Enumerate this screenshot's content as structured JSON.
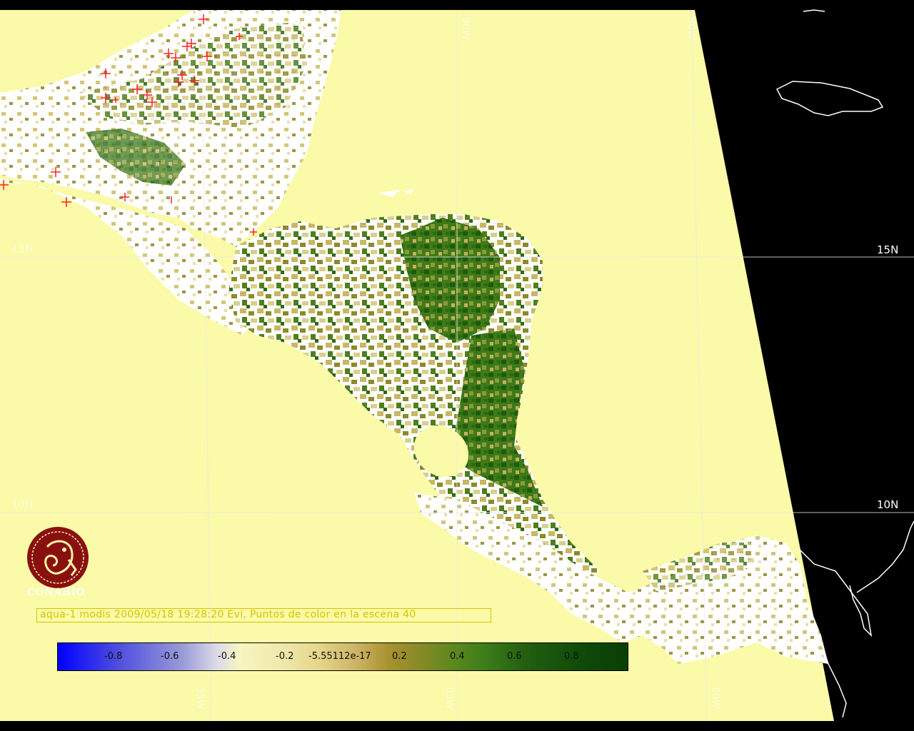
{
  "caption": "aqua-1 modis 2009/05/18 19:28:20 Evi, Puntos de color en la escena 40",
  "logo_text": "CONABIO",
  "graticule": {
    "lat_labels": [
      "15N",
      "10N"
    ],
    "lon_labels": [
      "95W",
      "90W",
      "85W",
      "80W"
    ]
  },
  "colorbar": {
    "ticks": [
      "-0.8",
      "-0.6",
      "-0.4",
      "-0.2",
      "-5.55112e-17",
      "0.2",
      "0.4",
      "0.6",
      "0.8"
    ]
  },
  "colors": {
    "ocean": "#fafaa8",
    "outside_swath": "#000000",
    "no_data_land": "#ffffff",
    "low_evi": "#b9a34e",
    "high_evi": "#2b6e12",
    "fire_marks": "#ff2020",
    "caption": "#d6c400"
  }
}
